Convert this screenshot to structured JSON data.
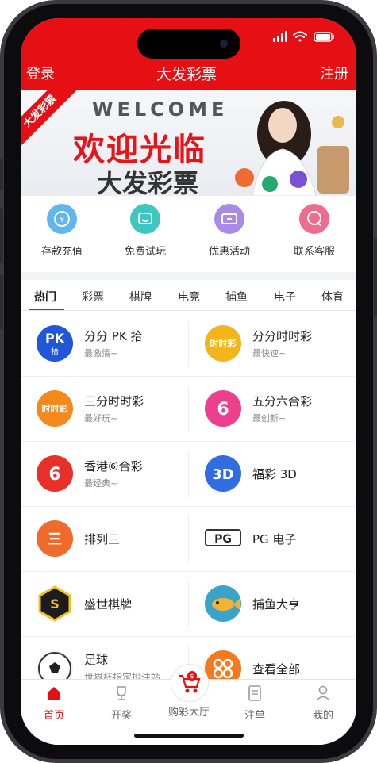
{
  "header": {
    "left_label": "登录",
    "title": "大发彩票",
    "right_label": "注册"
  },
  "banner": {
    "ribbon": "大发彩票",
    "welcome": "WELCOME",
    "title": "欢迎光临",
    "subtitle": "大发彩票"
  },
  "quick_actions": [
    {
      "label": "存款充值",
      "icon": "deposit-icon",
      "color": "#5fb7ee"
    },
    {
      "label": "免费试玩",
      "icon": "trial-icon",
      "color": "#3ec6c0"
    },
    {
      "label": "优惠活动",
      "icon": "promo-icon",
      "color": "#a98ae6"
    },
    {
      "label": "联系客服",
      "icon": "service-icon",
      "color": "#f06c8e"
    }
  ],
  "tabs": [
    "热门",
    "彩票",
    "棋牌",
    "电竞",
    "捕鱼",
    "电子",
    "体育"
  ],
  "games": [
    {
      "title": "分分 PK 拾",
      "subtitle": "最激情~",
      "icon_text": "PK拾"
    },
    {
      "title": "分分时时彩",
      "subtitle": "最快速~",
      "icon_text": "时时彩"
    },
    {
      "title": "三分时时彩",
      "subtitle": "最好玩~",
      "icon_text": "时时彩"
    },
    {
      "title": "五分六合彩",
      "subtitle": "最创新~",
      "icon_text": "6"
    },
    {
      "title": "香港⑥合彩",
      "subtitle": "最经典~",
      "icon_text": "6"
    },
    {
      "title": "福彩 3D",
      "subtitle": "",
      "icon_text": "3D"
    },
    {
      "title": "排列三",
      "subtitle": "",
      "icon_text": "三"
    },
    {
      "title": "PG 电子",
      "subtitle": "",
      "icon_text": "PG"
    },
    {
      "title": "盛世棋牌",
      "subtitle": "",
      "icon_text": "S"
    },
    {
      "title": "捕鱼大亨",
      "subtitle": "",
      "icon_text": ""
    },
    {
      "title": "足球",
      "subtitle": "世界杯指定投注站",
      "icon_text": ""
    },
    {
      "title": "查看全部",
      "subtitle": "",
      "icon_text": ""
    }
  ],
  "tabbar": [
    {
      "label": "首页",
      "icon": "home-icon",
      "active": true
    },
    {
      "label": "开奖",
      "icon": "trophy-icon",
      "active": false
    },
    {
      "label": "购彩大厅",
      "icon": "cart-icon",
      "active": false
    },
    {
      "label": "注单",
      "icon": "order-icon",
      "active": false
    },
    {
      "label": "我的",
      "icon": "profile-icon",
      "active": false
    }
  ],
  "colors": {
    "brand": "#e60f14",
    "tab_active": "#e60f14"
  }
}
